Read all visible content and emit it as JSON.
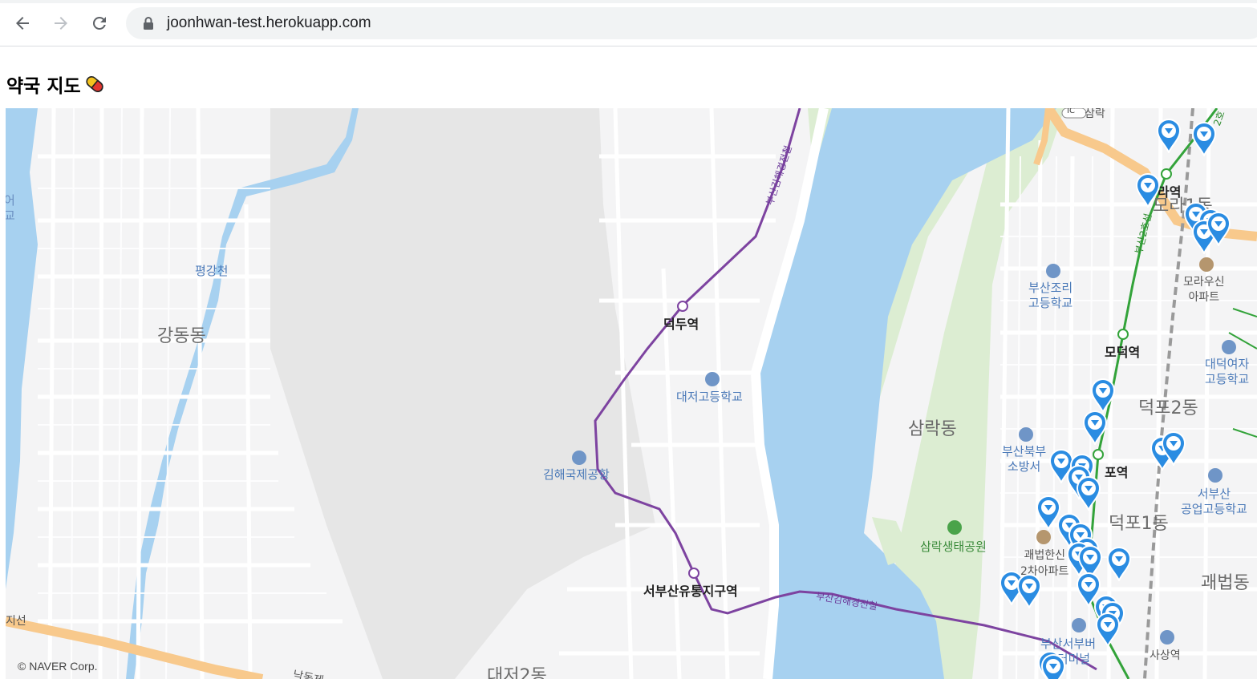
{
  "browser": {
    "url": "joonhwan-test.herokuapp.com"
  },
  "page": {
    "title": "약국 지도"
  },
  "map": {
    "credit": "© NAVER Corp.",
    "dong_labels": [
      "강동동",
      "삼락동",
      "덕포2동",
      "덕포1동",
      "괘법동",
      "대저2동",
      "모라1동"
    ],
    "stations": [
      "덕두역",
      "서부산유통지구역",
      "모덕역",
      "라역",
      "포역",
      "사상역"
    ],
    "poi_labels": {
      "pyeonggangcheon": "평강천",
      "airport": "김해국제공항",
      "daejeo_high": "대저고등학교",
      "busan_jori": "부산조리\n고등학교",
      "daeduk_girls": "대덕여자\n고등학교",
      "seobusan_tech": "서부산\n공업고등학교",
      "moraushin": "모라우신\n아파트",
      "fire_station": "부산북부\n소방서",
      "gwaebeop_hansin": "괘법한신\n2차아파트",
      "bus_terminal": "부산서부버\n스터미널",
      "samrak_park": "삼락생태공원",
      "samrak_ic": "삼락",
      "ic": "IC",
      "edge_left": "어\n교",
      "road_jiseon": "지선",
      "road_nakdong": "낙동제"
    },
    "rail_labels": {
      "bgl": "부산김해경전철",
      "line2": "부산2호선",
      "line2_top": "2호"
    },
    "colors": {
      "water": "#a7d1f0",
      "park": "#dcedd2",
      "road": "#ffffff",
      "highway": "#f8c98c",
      "light_rail": "#7d43a0",
      "subway2": "#33a33a",
      "marker": "#2a8ce2"
    },
    "pharmacy_marker_count": 38
  }
}
